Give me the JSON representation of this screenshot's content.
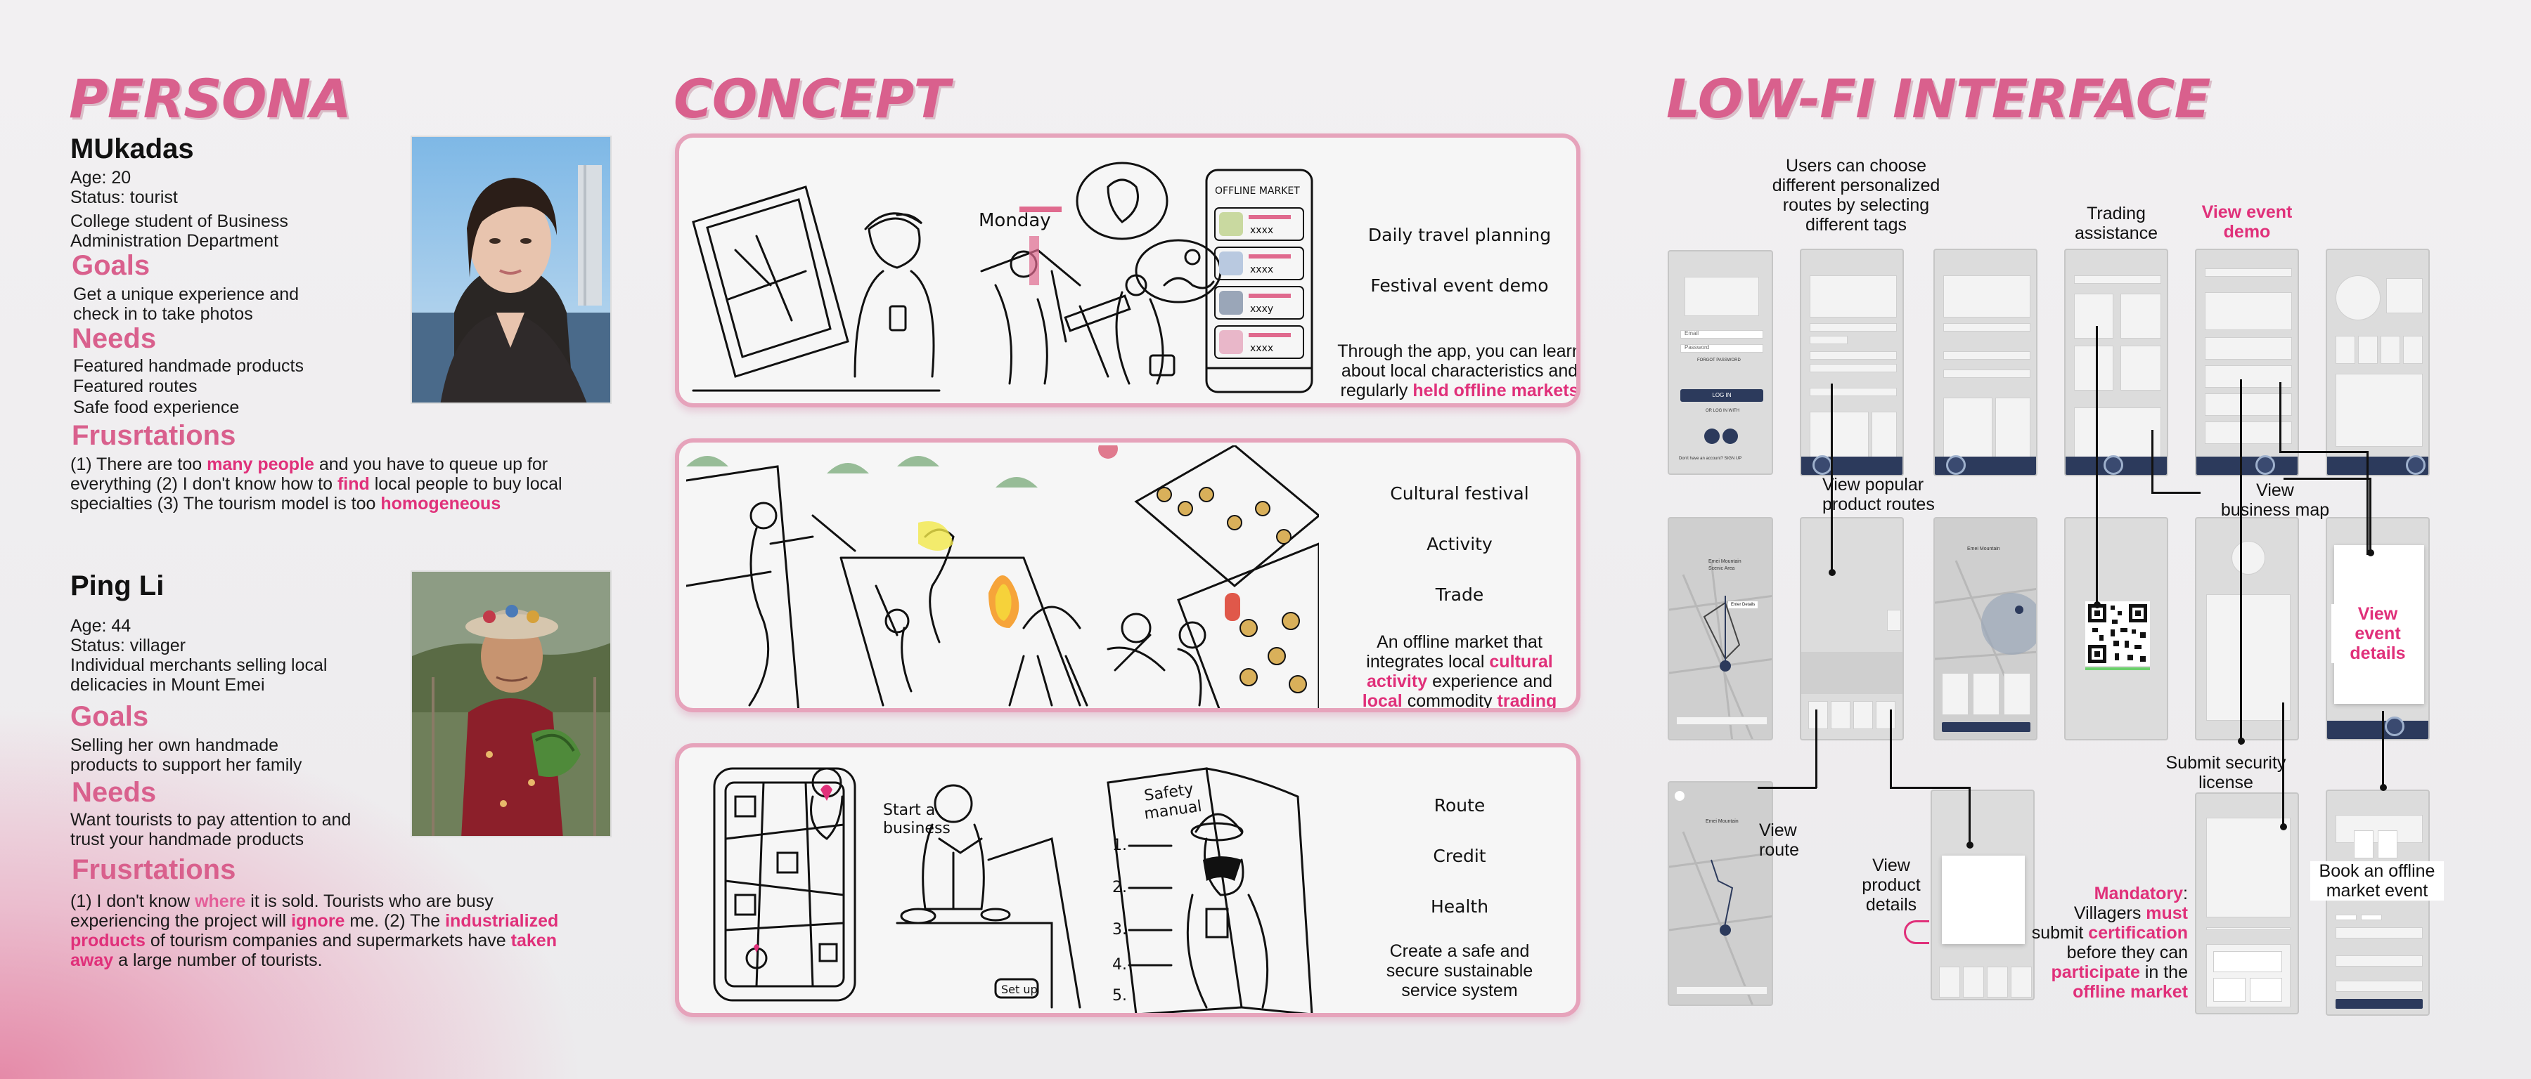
{
  "persona": {
    "title": "PERSONA",
    "p1": {
      "name": "MUkadas",
      "age": "Age: 20",
      "status": "Status: tourist",
      "occupation_1": "College student of Business",
      "occupation_2": "Administration Department",
      "goals_title": "Goals",
      "goals_1": "Get a unique experience and",
      "goals_2": "check in to take photos",
      "needs_title": "Needs",
      "needs": [
        "Featured handmade products",
        "Featured routes",
        "Safe food experience"
      ],
      "frus_title": "Frusrtations",
      "frus_a": "(1) There are too ",
      "frus_b": "many people",
      "frus_c": " and you have to queue up for",
      "frus_d": "everything (2) I don't know how to ",
      "frus_e": "find",
      "frus_f": " local people to buy local",
      "frus_g": "specialties (3) The tourism model is too ",
      "frus_h": "homogeneous"
    },
    "p2": {
      "name": "Ping Li",
      "age": "Age: 44",
      "status": "Status: villager",
      "occupation_1": "Individual merchants selling local",
      "occupation_2": "delicacies in Mount Emei",
      "goals_title": "Goals",
      "goals_1": "Selling her own handmade",
      "goals_2": "products to support her family",
      "needs_title": "Needs",
      "needs_1": "Want tourists to pay attention to and",
      "needs_2": "trust your handmade products",
      "frus_title": "Frusrtations",
      "f1a": "(1) I don't know ",
      "f1b": "where",
      "f1c": " it is sold. Tourists who are busy",
      "f2a": "experiencing the project will ",
      "f2b": "ignore",
      "f2c": " me. (2) The ",
      "f2d": "industrialized",
      "f3a": "products",
      "f3b": " of tourism companies and supermarkets have ",
      "f3c": "taken",
      "f4a": "away",
      "f4b": " a large number of tourists."
    }
  },
  "concept": {
    "title": "CONCEPT",
    "card1": {
      "k1": "Daily travel planning",
      "k2": "Festival event demo",
      "d1": "Through the app, you can learn",
      "d2": "about local characteristics and",
      "d3a": "regularly ",
      "d3b": "held offline markets",
      "sketch_monday": "Monday",
      "phone_title": "OFFLINE MARKET",
      "phone_items": [
        "xxxx",
        "xxxx",
        "xxxy",
        "xxxx"
      ]
    },
    "card2": {
      "k1": "Cultural festival",
      "k2": "Activity",
      "k3": "Trade",
      "d1": "An offline market that",
      "d2a": "integrates local ",
      "d2b": "cultural",
      "d3a": "activity",
      "d3b": " experience and",
      "d4a": "local",
      "d4b": " commodity ",
      "d4c": "trading"
    },
    "card3": {
      "k1": "Route",
      "k2": "Credit",
      "k3": "Health",
      "d1": "Create a safe and",
      "d2": "secure sustainable",
      "d3": "service system",
      "sketch_business_1": "Start a",
      "sketch_business_2": "business",
      "sketch_manual_1": "Safety",
      "sketch_manual_2": "manual",
      "sketch_setup": "Set up",
      "sketch_list": [
        "1.",
        "2.",
        "3.",
        "4.",
        "5."
      ]
    }
  },
  "lowfi": {
    "title": "LOW-FI INTERFACE",
    "a_tags": [
      "Users can choose",
      "different personalized",
      "routes by selecting",
      "different tags"
    ],
    "a_trading": [
      "Trading",
      "assistance"
    ],
    "a_event_demo": [
      "View event",
      "demo"
    ],
    "a_popular": [
      "View popular",
      "product routes"
    ],
    "a_map": [
      "View",
      "business map"
    ],
    "a_event_details": [
      "View",
      "event",
      "details"
    ],
    "a_route": [
      "View",
      "route"
    ],
    "a_product": [
      "View",
      "product",
      "details"
    ],
    "a_security": [
      "Submit security",
      "license"
    ],
    "a_book": [
      "Book an offline",
      "market event"
    ],
    "mand_1a": "Mandatory",
    "mand_1b": ":",
    "mand_2a": "Villagers ",
    "mand_2b": "must",
    "mand_3a": "submit ",
    "mand_3b": "certification",
    "mand_4": "before they can",
    "mand_5a": "participate",
    "mand_5b": " in the",
    "mand_6": "offline market",
    "login_email": "Email",
    "login_password": "Password",
    "login_forgot": "FORGOT PASSWORD",
    "login_btn": "LOG IN",
    "login_or": "OR LOG IN WITH",
    "login_signup": "Don't have an account?  SIGN UP",
    "map_place_1": "Emei Mountain",
    "map_place_2": "Scenic Area",
    "map_button": "Enter Details"
  },
  "colors": {
    "accent": "#d9608d",
    "highlight": "#e0307a",
    "navbar": "#2c3a5c",
    "wireframe": "#dcdcdc"
  }
}
